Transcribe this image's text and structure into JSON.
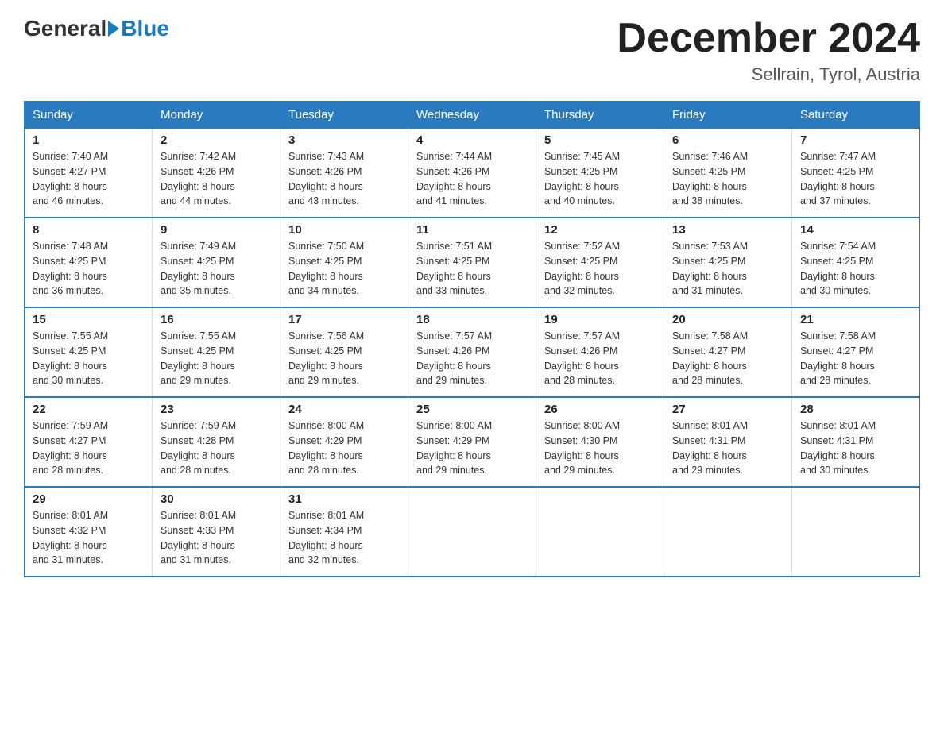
{
  "header": {
    "logo_general": "General",
    "logo_blue": "Blue",
    "month_title": "December 2024",
    "location": "Sellrain, Tyrol, Austria"
  },
  "days_of_week": [
    "Sunday",
    "Monday",
    "Tuesday",
    "Wednesday",
    "Thursday",
    "Friday",
    "Saturday"
  ],
  "weeks": [
    [
      {
        "day": "1",
        "info": "Sunrise: 7:40 AM\nSunset: 4:27 PM\nDaylight: 8 hours\nand 46 minutes."
      },
      {
        "day": "2",
        "info": "Sunrise: 7:42 AM\nSunset: 4:26 PM\nDaylight: 8 hours\nand 44 minutes."
      },
      {
        "day": "3",
        "info": "Sunrise: 7:43 AM\nSunset: 4:26 PM\nDaylight: 8 hours\nand 43 minutes."
      },
      {
        "day": "4",
        "info": "Sunrise: 7:44 AM\nSunset: 4:26 PM\nDaylight: 8 hours\nand 41 minutes."
      },
      {
        "day": "5",
        "info": "Sunrise: 7:45 AM\nSunset: 4:25 PM\nDaylight: 8 hours\nand 40 minutes."
      },
      {
        "day": "6",
        "info": "Sunrise: 7:46 AM\nSunset: 4:25 PM\nDaylight: 8 hours\nand 38 minutes."
      },
      {
        "day": "7",
        "info": "Sunrise: 7:47 AM\nSunset: 4:25 PM\nDaylight: 8 hours\nand 37 minutes."
      }
    ],
    [
      {
        "day": "8",
        "info": "Sunrise: 7:48 AM\nSunset: 4:25 PM\nDaylight: 8 hours\nand 36 minutes."
      },
      {
        "day": "9",
        "info": "Sunrise: 7:49 AM\nSunset: 4:25 PM\nDaylight: 8 hours\nand 35 minutes."
      },
      {
        "day": "10",
        "info": "Sunrise: 7:50 AM\nSunset: 4:25 PM\nDaylight: 8 hours\nand 34 minutes."
      },
      {
        "day": "11",
        "info": "Sunrise: 7:51 AM\nSunset: 4:25 PM\nDaylight: 8 hours\nand 33 minutes."
      },
      {
        "day": "12",
        "info": "Sunrise: 7:52 AM\nSunset: 4:25 PM\nDaylight: 8 hours\nand 32 minutes."
      },
      {
        "day": "13",
        "info": "Sunrise: 7:53 AM\nSunset: 4:25 PM\nDaylight: 8 hours\nand 31 minutes."
      },
      {
        "day": "14",
        "info": "Sunrise: 7:54 AM\nSunset: 4:25 PM\nDaylight: 8 hours\nand 30 minutes."
      }
    ],
    [
      {
        "day": "15",
        "info": "Sunrise: 7:55 AM\nSunset: 4:25 PM\nDaylight: 8 hours\nand 30 minutes."
      },
      {
        "day": "16",
        "info": "Sunrise: 7:55 AM\nSunset: 4:25 PM\nDaylight: 8 hours\nand 29 minutes."
      },
      {
        "day": "17",
        "info": "Sunrise: 7:56 AM\nSunset: 4:25 PM\nDaylight: 8 hours\nand 29 minutes."
      },
      {
        "day": "18",
        "info": "Sunrise: 7:57 AM\nSunset: 4:26 PM\nDaylight: 8 hours\nand 29 minutes."
      },
      {
        "day": "19",
        "info": "Sunrise: 7:57 AM\nSunset: 4:26 PM\nDaylight: 8 hours\nand 28 minutes."
      },
      {
        "day": "20",
        "info": "Sunrise: 7:58 AM\nSunset: 4:27 PM\nDaylight: 8 hours\nand 28 minutes."
      },
      {
        "day": "21",
        "info": "Sunrise: 7:58 AM\nSunset: 4:27 PM\nDaylight: 8 hours\nand 28 minutes."
      }
    ],
    [
      {
        "day": "22",
        "info": "Sunrise: 7:59 AM\nSunset: 4:27 PM\nDaylight: 8 hours\nand 28 minutes."
      },
      {
        "day": "23",
        "info": "Sunrise: 7:59 AM\nSunset: 4:28 PM\nDaylight: 8 hours\nand 28 minutes."
      },
      {
        "day": "24",
        "info": "Sunrise: 8:00 AM\nSunset: 4:29 PM\nDaylight: 8 hours\nand 28 minutes."
      },
      {
        "day": "25",
        "info": "Sunrise: 8:00 AM\nSunset: 4:29 PM\nDaylight: 8 hours\nand 29 minutes."
      },
      {
        "day": "26",
        "info": "Sunrise: 8:00 AM\nSunset: 4:30 PM\nDaylight: 8 hours\nand 29 minutes."
      },
      {
        "day": "27",
        "info": "Sunrise: 8:01 AM\nSunset: 4:31 PM\nDaylight: 8 hours\nand 29 minutes."
      },
      {
        "day": "28",
        "info": "Sunrise: 8:01 AM\nSunset: 4:31 PM\nDaylight: 8 hours\nand 30 minutes."
      }
    ],
    [
      {
        "day": "29",
        "info": "Sunrise: 8:01 AM\nSunset: 4:32 PM\nDaylight: 8 hours\nand 31 minutes."
      },
      {
        "day": "30",
        "info": "Sunrise: 8:01 AM\nSunset: 4:33 PM\nDaylight: 8 hours\nand 31 minutes."
      },
      {
        "day": "31",
        "info": "Sunrise: 8:01 AM\nSunset: 4:34 PM\nDaylight: 8 hours\nand 32 minutes."
      },
      {
        "day": "",
        "info": ""
      },
      {
        "day": "",
        "info": ""
      },
      {
        "day": "",
        "info": ""
      },
      {
        "day": "",
        "info": ""
      }
    ]
  ]
}
